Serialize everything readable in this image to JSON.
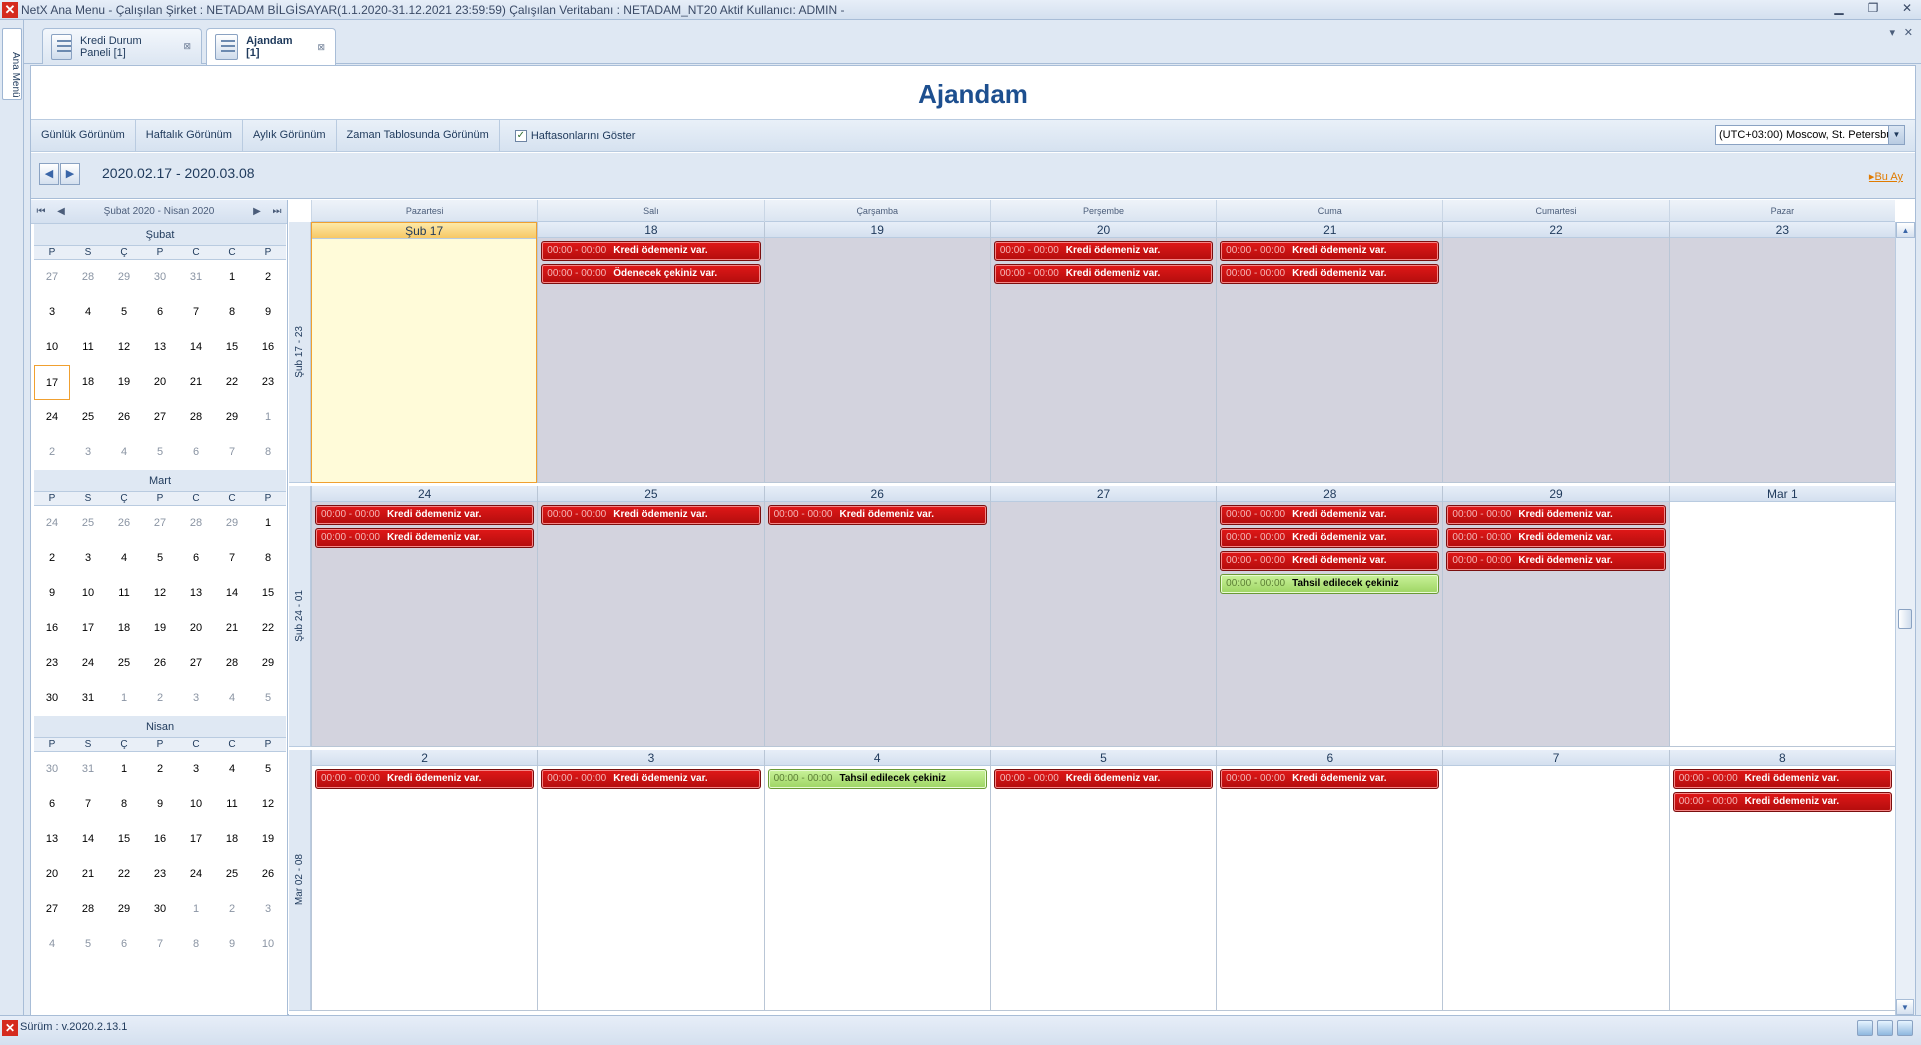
{
  "window": {
    "title": "NetX Ana Menu - Çalışılan Şirket : NETADAM BİLGİSAYAR(1.1.2020-31.12.2021 23:59:59) Çalışılan Veritabanı : NETADAM_NT20  Aktif Kullanıcı: ADMIN -",
    "minimize": "▁",
    "restore": "❐",
    "close": "✕"
  },
  "left_strip": {
    "label": "Ana Menü"
  },
  "tabs": [
    {
      "label": "Kredi Durum Paneli [1]",
      "close": "⊠"
    },
    {
      "label": "Ajandam [1]",
      "close": "⊠"
    }
  ],
  "tab_ctrl": {
    "dropdown": "▾",
    "close": "✕"
  },
  "page": {
    "title": "Ajandam"
  },
  "toolbar": {
    "daily": "Günlük Görünüm",
    "weekly": "Haftalık Görünüm",
    "monthly": "Aylık Görünüm",
    "timeline": "Zaman Tablosunda Görünüm",
    "show_weekends": "Haftasonlarını Göster",
    "show_weekends_checked": true,
    "timezone": "(UTC+03:00) Moscow, St. Petersbu"
  },
  "nav": {
    "prev": "◀",
    "next": "▶",
    "date_range": "2020.02.17 - 2020.03.08",
    "this_month": "Bu Ay"
  },
  "sidebar": {
    "range_label": "Şubat 2020 - Nisan 2020",
    "nav": {
      "first": "⏮",
      "prev": "◀",
      "next": "▶",
      "last": "⏭"
    },
    "weekday_headers": [
      "P",
      "S",
      "Ç",
      "P",
      "C",
      "C",
      "P"
    ],
    "months": [
      {
        "name": "Şubat",
        "weeks": [
          [
            "27",
            "28",
            "29",
            "30",
            "31",
            "1",
            "2"
          ],
          [
            "3",
            "4",
            "5",
            "6",
            "7",
            "8",
            "9"
          ],
          [
            "10",
            "11",
            "12",
            "13",
            "14",
            "15",
            "16"
          ],
          [
            "17",
            "18",
            "19",
            "20",
            "21",
            "22",
            "23"
          ],
          [
            "24",
            "25",
            "26",
            "27",
            "28",
            "29",
            "1"
          ],
          [
            "2",
            "3",
            "4",
            "5",
            "6",
            "7",
            "8"
          ]
        ]
      },
      {
        "name": "Mart",
        "weeks": [
          [
            "24",
            "25",
            "26",
            "27",
            "28",
            "29",
            "1"
          ],
          [
            "2",
            "3",
            "4",
            "5",
            "6",
            "7",
            "8"
          ],
          [
            "9",
            "10",
            "11",
            "12",
            "13",
            "14",
            "15"
          ],
          [
            "16",
            "17",
            "18",
            "19",
            "20",
            "21",
            "22"
          ],
          [
            "23",
            "24",
            "25",
            "26",
            "27",
            "28",
            "29"
          ],
          [
            "30",
            "31",
            "1",
            "2",
            "3",
            "4",
            "5"
          ]
        ]
      },
      {
        "name": "Nisan",
        "weeks": [
          [
            "30",
            "31",
            "1",
            "2",
            "3",
            "4",
            "5"
          ],
          [
            "6",
            "7",
            "8",
            "9",
            "10",
            "11",
            "12"
          ],
          [
            "13",
            "14",
            "15",
            "16",
            "17",
            "18",
            "19"
          ],
          [
            "20",
            "21",
            "22",
            "23",
            "24",
            "25",
            "26"
          ],
          [
            "27",
            "28",
            "29",
            "30",
            "1",
            "2",
            "3"
          ],
          [
            "4",
            "5",
            "6",
            "7",
            "8",
            "9",
            "10"
          ]
        ]
      }
    ]
  },
  "calendar": {
    "day_headers": [
      "Pazartesi",
      "Salı",
      "Çarşamba",
      "Perşembe",
      "Cuma",
      "Cumartesi",
      "Pazar"
    ],
    "weeks": [
      {
        "label": "Şub 17 - 23",
        "days": [
          {
            "num": "Şub 17",
            "today": true,
            "appts": []
          },
          {
            "num": "18",
            "grey": true,
            "appts": [
              {
                "time": "00:00 - 00:00",
                "subject": "Kredi ödemeniz var.",
                "color": "red"
              },
              {
                "time": "00:00 - 00:00",
                "subject": "Ödenecek çekiniz var.",
                "color": "red"
              }
            ]
          },
          {
            "num": "19",
            "grey": true,
            "appts": []
          },
          {
            "num": "20",
            "grey": true,
            "appts": [
              {
                "time": "00:00 - 00:00",
                "subject": "Kredi ödemeniz var.",
                "color": "red"
              },
              {
                "time": "00:00 - 00:00",
                "subject": "Kredi ödemeniz var.",
                "color": "red"
              }
            ]
          },
          {
            "num": "21",
            "grey": true,
            "appts": [
              {
                "time": "00:00 - 00:00",
                "subject": "Kredi ödemeniz var.",
                "color": "red"
              },
              {
                "time": "00:00 - 00:00",
                "subject": "Kredi ödemeniz var.",
                "color": "red"
              }
            ]
          },
          {
            "num": "22",
            "grey": true,
            "appts": []
          },
          {
            "num": "23",
            "grey": true,
            "appts": []
          }
        ]
      },
      {
        "label": "Şub 24 - 01",
        "days": [
          {
            "num": "24",
            "grey": true,
            "appts": [
              {
                "time": "00:00 - 00:00",
                "subject": "Kredi ödemeniz var.",
                "color": "red"
              },
              {
                "time": "00:00 - 00:00",
                "subject": "Kredi ödemeniz var.",
                "color": "red"
              }
            ]
          },
          {
            "num": "25",
            "grey": true,
            "appts": [
              {
                "time": "00:00 - 00:00",
                "subject": "Kredi ödemeniz var.",
                "color": "red"
              }
            ]
          },
          {
            "num": "26",
            "grey": true,
            "appts": [
              {
                "time": "00:00 - 00:00",
                "subject": "Kredi ödemeniz var.",
                "color": "red"
              }
            ]
          },
          {
            "num": "27",
            "grey": true,
            "appts": []
          },
          {
            "num": "28",
            "grey": true,
            "appts": [
              {
                "time": "00:00 - 00:00",
                "subject": "Kredi ödemeniz var.",
                "color": "red"
              },
              {
                "time": "00:00 - 00:00",
                "subject": "Kredi ödemeniz var.",
                "color": "red"
              },
              {
                "time": "00:00 - 00:00",
                "subject": "Kredi ödemeniz var.",
                "color": "red"
              },
              {
                "time": "00:00 - 00:00",
                "subject": "Tahsil edilecek çekiniz",
                "color": "green"
              }
            ]
          },
          {
            "num": "29",
            "grey": true,
            "appts": [
              {
                "time": "00:00 - 00:00",
                "subject": "Kredi ödemeniz var.",
                "color": "red"
              },
              {
                "time": "00:00 - 00:00",
                "subject": "Kredi ödemeniz var.",
                "color": "red"
              },
              {
                "time": "00:00 - 00:00",
                "subject": "Kredi ödemeniz var.",
                "color": "red"
              }
            ]
          },
          {
            "num": "Mar 1",
            "appts": []
          }
        ]
      },
      {
        "label": "Mar 02 - 08",
        "days": [
          {
            "num": "2",
            "appts": [
              {
                "time": "00:00 - 00:00",
                "subject": "Kredi ödemeniz var.",
                "color": "red"
              }
            ]
          },
          {
            "num": "3",
            "appts": [
              {
                "time": "00:00 - 00:00",
                "subject": "Kredi ödemeniz var.",
                "color": "red"
              }
            ]
          },
          {
            "num": "4",
            "appts": [
              {
                "time": "00:00 - 00:00",
                "subject": "Tahsil edilecek çekiniz",
                "color": "green"
              }
            ]
          },
          {
            "num": "5",
            "appts": [
              {
                "time": "00:00 - 00:00",
                "subject": "Kredi ödemeniz var.",
                "color": "red"
              }
            ]
          },
          {
            "num": "6",
            "appts": [
              {
                "time": "00:00 - 00:00",
                "subject": "Kredi ödemeniz var.",
                "color": "red"
              }
            ]
          },
          {
            "num": "7",
            "appts": []
          },
          {
            "num": "8",
            "appts": [
              {
                "time": "00:00 - 00:00",
                "subject": "Kredi ödemeniz var.",
                "color": "red"
              },
              {
                "time": "00:00 - 00:00",
                "subject": "Kredi ödemeniz var.",
                "color": "red"
              }
            ]
          }
        ]
      }
    ]
  },
  "status": {
    "version": "Sürüm : v.2020.2.13.1"
  },
  "colors": {
    "accent": "#1d4f8f",
    "appt_red": "#c81212",
    "appt_green": "#a8dd6e",
    "today_bg": "#fffbd9"
  }
}
